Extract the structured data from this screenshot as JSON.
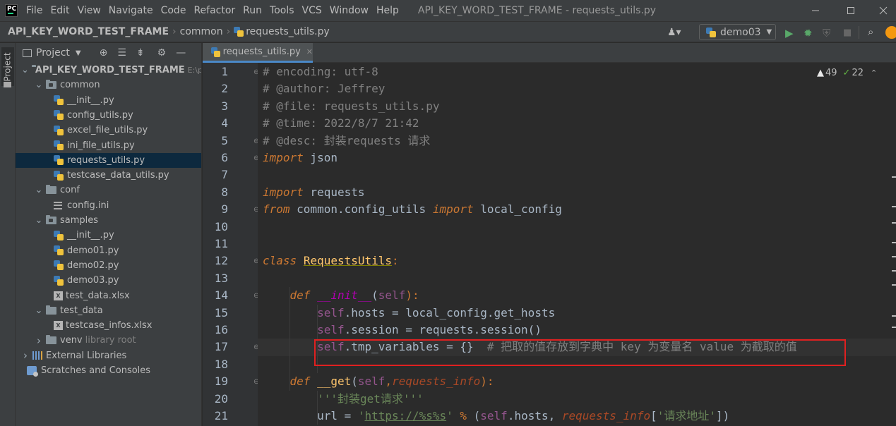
{
  "app": {
    "logo_text": "PC",
    "menu": [
      "File",
      "Edit",
      "View",
      "Navigate",
      "Code",
      "Refactor",
      "Run",
      "Tools",
      "VCS",
      "Window",
      "Help"
    ],
    "window_title": "API_KEY_WORD_TEST_FRAME - requests_utils.py"
  },
  "breadcrumb": {
    "project": "API_KEY_WORD_TEST_FRAME",
    "folder": "common",
    "file": "requests_utils.py"
  },
  "run_config": "demo03",
  "tool_window": {
    "stripe_label": "Project",
    "header": "Project"
  },
  "tree": [
    {
      "label": "API_KEY_WORD_TEST_FRAME",
      "suffix": "E:\\p",
      "indent": 0,
      "type": "root",
      "expanded": true
    },
    {
      "label": "common",
      "indent": 1,
      "type": "package",
      "expanded": true
    },
    {
      "label": "__init__.py",
      "indent": 2,
      "type": "py"
    },
    {
      "label": "config_utils.py",
      "indent": 2,
      "type": "py"
    },
    {
      "label": "excel_file_utils.py",
      "indent": 2,
      "type": "py"
    },
    {
      "label": "ini_file_utils.py",
      "indent": 2,
      "type": "py"
    },
    {
      "label": "requests_utils.py",
      "indent": 2,
      "type": "py",
      "selected": true
    },
    {
      "label": "testcase_data_utils.py",
      "indent": 2,
      "type": "py"
    },
    {
      "label": "conf",
      "indent": 1,
      "type": "folder",
      "expanded": true
    },
    {
      "label": "config.ini",
      "indent": 2,
      "type": "cfg"
    },
    {
      "label": "samples",
      "indent": 1,
      "type": "package",
      "expanded": true
    },
    {
      "label": "__init__.py",
      "indent": 2,
      "type": "py"
    },
    {
      "label": "demo01.py",
      "indent": 2,
      "type": "py"
    },
    {
      "label": "demo02.py",
      "indent": 2,
      "type": "py"
    },
    {
      "label": "demo03.py",
      "indent": 2,
      "type": "py"
    },
    {
      "label": "test_data.xlsx",
      "indent": 2,
      "type": "xls"
    },
    {
      "label": "test_data",
      "indent": 1,
      "type": "folder",
      "expanded": true
    },
    {
      "label": "testcase_infos.xlsx",
      "indent": 2,
      "type": "xls"
    },
    {
      "label": "venv",
      "suffix": "library root",
      "indent": 1,
      "type": "folder",
      "expanded": false
    },
    {
      "label": "External Libraries",
      "indent": 0,
      "type": "lib",
      "expanded": false
    },
    {
      "label": "Scratches and Consoles",
      "indent": 0,
      "type": "scratch"
    }
  ],
  "editor": {
    "tab_label": "requests_utils.py",
    "inspections": {
      "warnings": "49",
      "typos": "22"
    },
    "current_line": 17,
    "lines": [
      {
        "n": "1",
        "tokens": [
          [
            "cm",
            "# encoding: utf-8"
          ]
        ]
      },
      {
        "n": "2",
        "tokens": [
          [
            "cm",
            "# @author: Jeffrey"
          ]
        ]
      },
      {
        "n": "3",
        "tokens": [
          [
            "cm",
            "# @file: requests_utils.py"
          ]
        ]
      },
      {
        "n": "4",
        "tokens": [
          [
            "cm",
            "# @time: 2022/8/7 21:42"
          ]
        ]
      },
      {
        "n": "5",
        "tokens": [
          [
            "cm",
            "# @desc: 封装requests 请求"
          ]
        ]
      },
      {
        "n": "6",
        "tokens": [
          [
            "kw",
            "import"
          ],
          [
            "",
            " json"
          ]
        ]
      },
      {
        "n": "7",
        "tokens": []
      },
      {
        "n": "8",
        "tokens": [
          [
            "kw",
            "import"
          ],
          [
            "",
            " requests"
          ]
        ]
      },
      {
        "n": "9",
        "tokens": [
          [
            "kw",
            "from"
          ],
          [
            "",
            " common.config_utils "
          ],
          [
            "kw",
            "import"
          ],
          [
            "",
            " local_config"
          ]
        ]
      },
      {
        "n": "10",
        "tokens": []
      },
      {
        "n": "11",
        "tokens": []
      },
      {
        "n": "12",
        "tokens": [
          [
            "kw",
            "class"
          ],
          [
            "",
            " "
          ],
          [
            "cls",
            "RequestsUtils"
          ],
          [
            "kwn",
            ":"
          ]
        ]
      },
      {
        "n": "13",
        "tokens": []
      },
      {
        "n": "14",
        "tokens": [
          [
            "",
            "    "
          ],
          [
            "kw",
            "def"
          ],
          [
            "",
            " "
          ],
          [
            "dun",
            "__init__"
          ],
          [
            "",
            "("
          ],
          [
            "slf",
            "self"
          ],
          [
            "kwn",
            "):"
          ]
        ]
      },
      {
        "n": "15",
        "tokens": [
          [
            "",
            "        "
          ],
          [
            "slf",
            "self"
          ],
          [
            "",
            ".hosts = local_config.get_hosts"
          ]
        ]
      },
      {
        "n": "16",
        "tokens": [
          [
            "",
            "        "
          ],
          [
            "slf",
            "self"
          ],
          [
            "",
            ".session = requests.session()"
          ]
        ]
      },
      {
        "n": "17",
        "tokens": [
          [
            "",
            "        "
          ],
          [
            "slf",
            "self"
          ],
          [
            "",
            ".tmp_variables = {}  "
          ],
          [
            "cm",
            "# 把取的值存放到字典中 key 为变量名 value 为截取的值"
          ]
        ]
      },
      {
        "n": "18",
        "tokens": []
      },
      {
        "n": "19",
        "tokens": [
          [
            "",
            "    "
          ],
          [
            "kw",
            "def"
          ],
          [
            "",
            " "
          ],
          [
            "fn",
            "__get"
          ],
          [
            "",
            "("
          ],
          [
            "slf",
            "self"
          ],
          [
            "kwn",
            ","
          ],
          [
            "par",
            "requests_info"
          ],
          [
            "kwn",
            "):"
          ]
        ]
      },
      {
        "n": "20",
        "tokens": [
          [
            "",
            "        "
          ],
          [
            "str",
            "'''封装get请求'''"
          ]
        ]
      },
      {
        "n": "21",
        "tokens": [
          [
            "",
            "        url = "
          ],
          [
            "str",
            "'"
          ],
          [
            "strl",
            "https://%s%s"
          ],
          [
            "str",
            "'"
          ],
          [
            "",
            " "
          ],
          [
            "kwn",
            "%"
          ],
          [
            "",
            " ("
          ],
          [
            "slf",
            "self"
          ],
          [
            "",
            ".hosts, "
          ],
          [
            "par",
            "requests_info"
          ],
          [
            "",
            "["
          ],
          [
            "str",
            "'请求地址'"
          ],
          [
            "",
            "])"
          ]
        ]
      }
    ]
  }
}
